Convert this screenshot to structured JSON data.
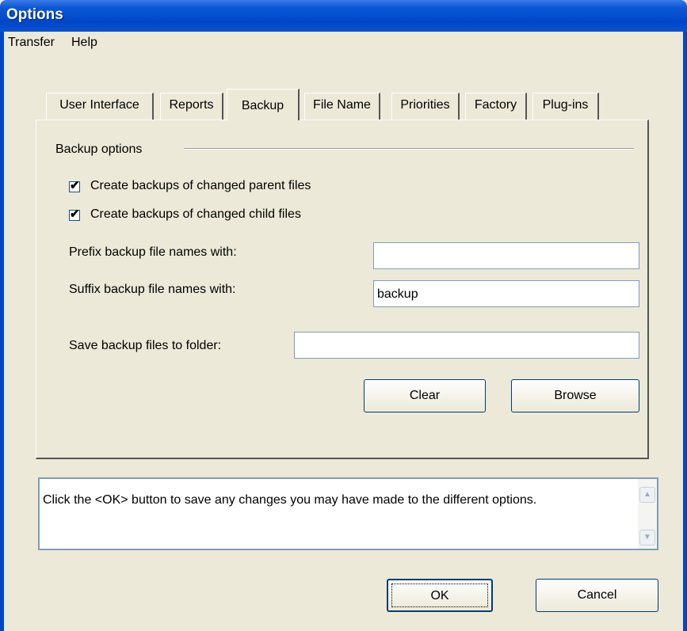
{
  "window": {
    "title": "Options"
  },
  "menu": {
    "transfer": "Transfer",
    "help": "Help"
  },
  "tabs": [
    {
      "label": "User Interface"
    },
    {
      "label": "Reports"
    },
    {
      "label": "Backup"
    },
    {
      "label": "File Name"
    },
    {
      "label": "Priorities"
    },
    {
      "label": "Factory"
    },
    {
      "label": "Plug-ins"
    }
  ],
  "backup": {
    "group_label": "Backup options",
    "parent_checkbox": {
      "label": "Create backups of changed parent files",
      "checked": true
    },
    "child_checkbox": {
      "label": "Create backups of changed child files",
      "checked": true
    },
    "prefix_label": "Prefix backup file names with:",
    "prefix_value": "",
    "suffix_label": "Suffix backup file names with:",
    "suffix_value": "backup",
    "folder_label": "Save backup files to folder:",
    "folder_value": "",
    "clear_label": "Clear",
    "browse_label": "Browse"
  },
  "status": {
    "message": "Click the <OK> button to save any changes you may have made to the different options."
  },
  "buttons": {
    "ok": "OK",
    "cancel": "Cancel"
  },
  "icons": {
    "check": "✔",
    "scroll_up": "▲",
    "scroll_down": "▼"
  }
}
